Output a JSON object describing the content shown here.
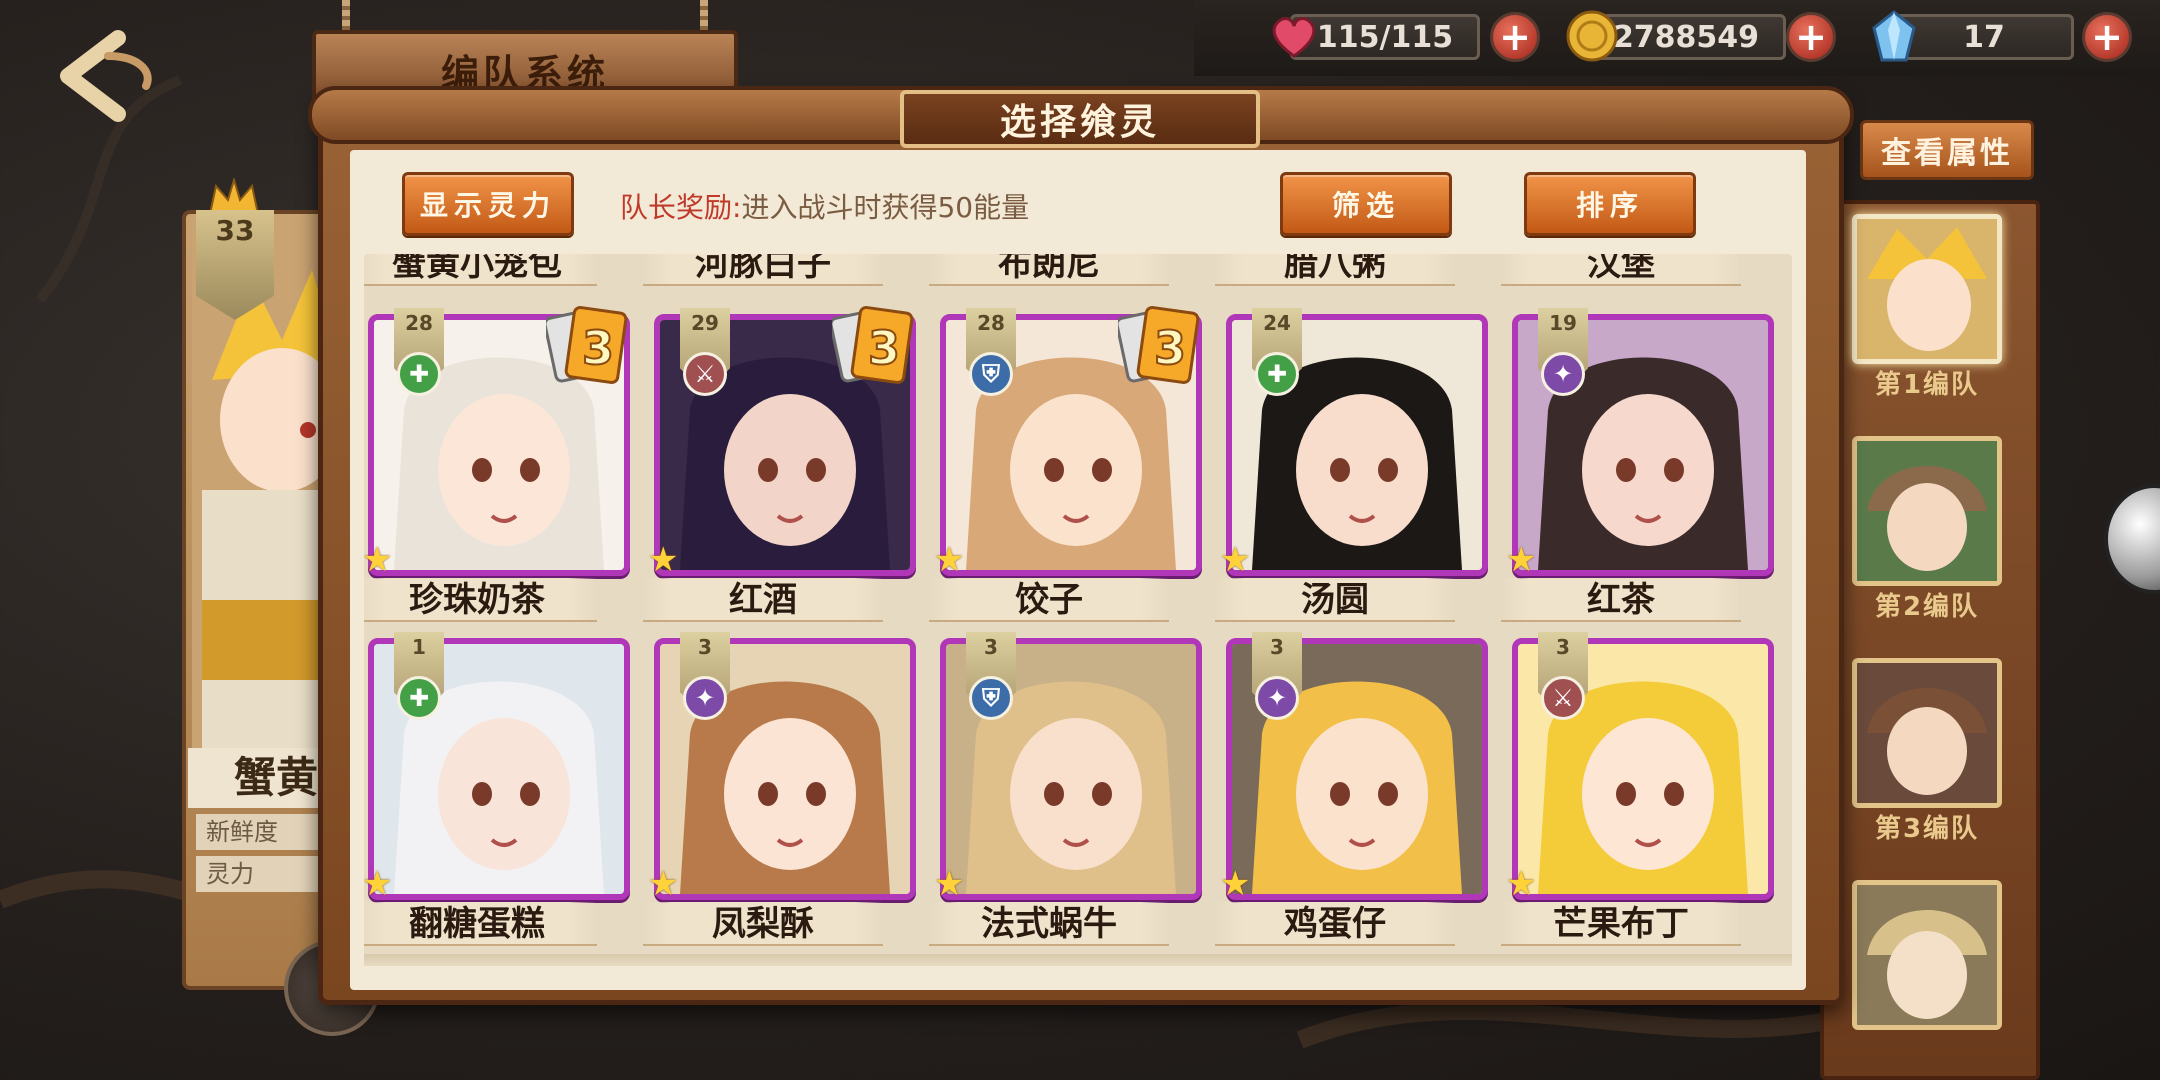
{
  "header": {
    "page_title": "编队系统"
  },
  "resources": {
    "stamina": "115/115",
    "gold": "2788549",
    "gems": "17"
  },
  "modal": {
    "title": "选择飨灵",
    "show_power_label": "显示灵力",
    "leader_bonus_label": "队长奖励:",
    "leader_bonus_text": "进入战斗时获得50能量",
    "filter_label": "筛选",
    "sort_label": "排序"
  },
  "top_row_names": [
    "蟹黄小笼包",
    "河豚白子",
    "布朗尼",
    "腊八粥",
    "汉堡"
  ],
  "cards": [
    {
      "name": "珍珠奶茶",
      "level": "28",
      "role": "heal",
      "dup": "3"
    },
    {
      "name": "红酒",
      "level": "29",
      "role": "attack",
      "dup": "3"
    },
    {
      "name": "饺子",
      "level": "28",
      "role": "defense",
      "dup": "3"
    },
    {
      "name": "汤圆",
      "level": "24",
      "role": "heal",
      "dup": ""
    },
    {
      "name": "红茶",
      "level": "19",
      "role": "magic",
      "dup": ""
    },
    {
      "name": "翻糖蛋糕",
      "level": "1",
      "role": "heal",
      "dup": ""
    },
    {
      "name": "凤梨酥",
      "level": "3",
      "role": "magic",
      "dup": ""
    },
    {
      "name": "法式蜗牛",
      "level": "3",
      "role": "defense",
      "dup": ""
    },
    {
      "name": "鸡蛋仔",
      "level": "3",
      "role": "magic",
      "dup": ""
    },
    {
      "name": "芒果布丁",
      "level": "3",
      "role": "attack",
      "dup": ""
    }
  ],
  "feature": {
    "level": "33",
    "name": "蟹黄小",
    "stat_freshness": "新鲜度",
    "stat_power": "灵力"
  },
  "side_panel": {
    "view_attr_label": "查看属性",
    "teams": [
      "第1编队",
      "第2编队",
      "第3编队"
    ]
  },
  "colors": {
    "card_border": "#b038b8",
    "button_orange": "#e07a30",
    "paper": "#f3e9d7",
    "heal_badge": "#43a047",
    "attack_badge": "#a05050",
    "defense_badge": "#3d6da8",
    "magic_badge": "#7d4aa8"
  },
  "icons": {
    "back": "back-arrow-icon",
    "stamina": "heart-icon",
    "gold": "coin-icon",
    "gems": "crystal-icon",
    "add": "plus-icon",
    "star": "star-icon"
  }
}
